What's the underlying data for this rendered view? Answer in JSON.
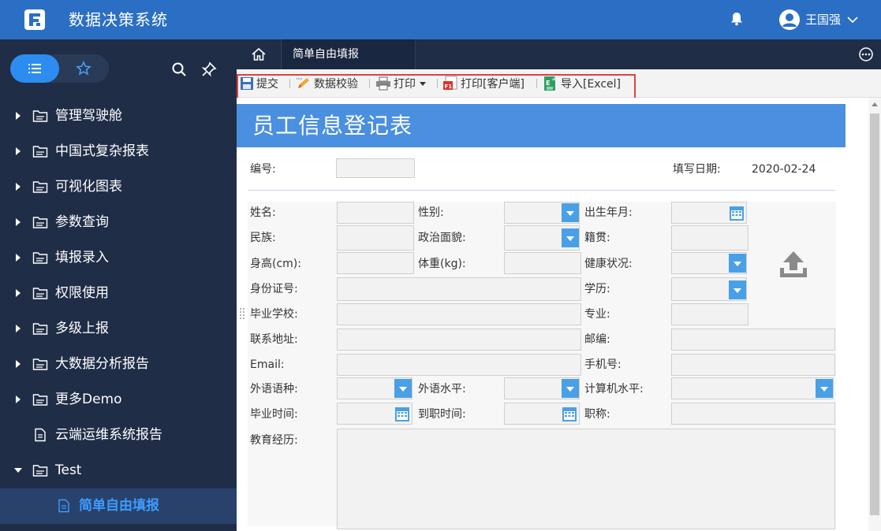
{
  "header": {
    "app_title": "数据决策系统",
    "user_name": "王国强",
    "brand_color": "#2b6fc4"
  },
  "sidebar": {
    "items": [
      {
        "label": "管理驾驶舱",
        "type": "folder",
        "expanded": false
      },
      {
        "label": "中国式复杂报表",
        "type": "folder",
        "expanded": false
      },
      {
        "label": "可视化图表",
        "type": "folder",
        "expanded": false
      },
      {
        "label": "参数查询",
        "type": "folder",
        "expanded": false
      },
      {
        "label": "填报录入",
        "type": "folder",
        "expanded": false
      },
      {
        "label": "权限使用",
        "type": "folder",
        "expanded": false
      },
      {
        "label": "多级上报",
        "type": "folder",
        "expanded": false
      },
      {
        "label": "大数据分析报告",
        "type": "folder",
        "expanded": false
      },
      {
        "label": "更多Demo",
        "type": "folder",
        "expanded": false
      },
      {
        "label": "云端运维系统报告",
        "type": "file"
      },
      {
        "label": "Test",
        "type": "folder",
        "expanded": true
      },
      {
        "label": "简单自由填报",
        "type": "file",
        "active": true
      }
    ]
  },
  "tabs": {
    "active_label": "简单自由填报"
  },
  "toolbar": {
    "submit": "提交",
    "validate": "数据校验",
    "print": "打印",
    "print_client": "打印[客户端]",
    "import_excel": "导入[Excel]"
  },
  "report": {
    "title": "员工信息登记表",
    "fields": {
      "number": "编号:",
      "fill_date_label": "填写日期:",
      "fill_date_value": "2020-02-24",
      "name": "姓名:",
      "gender": "性别:",
      "birth": "出生年月:",
      "ethnicity": "民族:",
      "political": "政治面貌:",
      "native": "籍贯:",
      "height": "身高(cm):",
      "weight": "体重(kg):",
      "health": "健康状况:",
      "id_no": "身份证号:",
      "education": "学历:",
      "school": "毕业学校:",
      "major": "专业:",
      "address": "联系地址:",
      "postcode": "邮编:",
      "email": "Email:",
      "mobile": "手机号:",
      "lang": "外语语种:",
      "lang_level": "外语水平:",
      "computer_level": "计算机水平:",
      "grad_time": "毕业时间:",
      "join_time": "到职时间:",
      "title_rank": "职称:",
      "edu_history": "教育经历:"
    }
  }
}
